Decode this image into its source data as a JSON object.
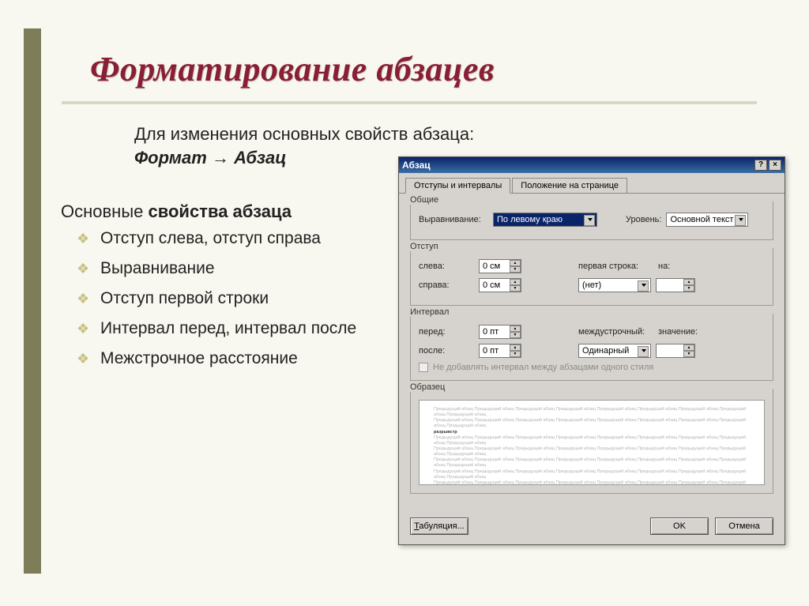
{
  "slide": {
    "title": "Форматирование абзацев",
    "subtitle_line1": "Для изменения основных свойств абзаца:",
    "subtitle_path_a": "Формат",
    "subtitle_path_b": "Абзац",
    "props_heading_a": "Основные",
    "props_heading_b": "свойства абзаца",
    "bullets": [
      "Отступ слева, отступ справа",
      "Выравнивание",
      "Отступ первой строки",
      "Интервал перед, интервал после",
      "Межстрочное расстояние"
    ]
  },
  "dialog": {
    "title": "Абзац",
    "help_btn": "?",
    "close_btn": "×",
    "tabs": {
      "t0": "Отступы и интервалы",
      "t1": "Положение на странице"
    },
    "groups": {
      "general": "Общие",
      "indent": "Отступ",
      "spacing": "Интервал",
      "preview": "Образец"
    },
    "labels": {
      "alignment": "Выравнивание:",
      "level": "Уровень:",
      "left": "слева:",
      "right": "справа:",
      "first_line": "первая строка:",
      "by": "на:",
      "before": "перед:",
      "after": "после:",
      "line_spacing": "междустрочный:",
      "value": "значение:"
    },
    "values": {
      "alignment": "По левому краю",
      "level": "Основной текст",
      "left": "0 см",
      "right": "0 см",
      "first_line": "(нет)",
      "by": "",
      "before": "0 пт",
      "after": "0 пт",
      "line_spacing": "Одинарный",
      "value": ""
    },
    "checkbox": "Не добавлять интервал между абзацами одного стиля",
    "buttons": {
      "tabs": "Табуляция...",
      "ok": "OK",
      "cancel": "Отмена"
    },
    "preview_mock": "Предыдущий абзац Предыдущий абзац Предыдущий абзац Предыдущий абзац Предыдущий абзац Предыдущий абзац Предыдущий абзац Предыдущий абзац Предыдущий абзац"
  }
}
